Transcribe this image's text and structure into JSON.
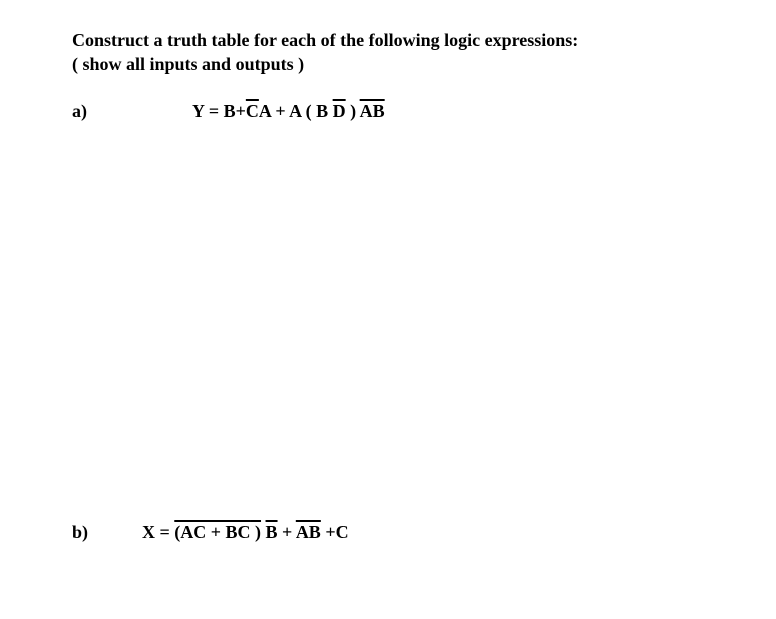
{
  "heading_line1": "Construct a truth table for each of the following logic expressions:",
  "heading_line2": "( show all inputs and outputs )",
  "problems": {
    "a": {
      "label": "a)",
      "expr": {
        "p1": "Y = B+",
        "p2_ov": "C",
        "p3": "A + A ( B ",
        "p4_ov": "D",
        "p5": " ) ",
        "p6_ov": "AB"
      }
    },
    "b": {
      "label": "b)",
      "expr": {
        "p1": "X = ",
        "p2_ov": "(AC + B",
        "p3_ov_inner": "C",
        "p4_ov_cont": " )",
        "p5": " ",
        "p6_ov": "B",
        "p7": "  + ",
        "p8_ov": "AB",
        "p9": " +C"
      }
    }
  }
}
